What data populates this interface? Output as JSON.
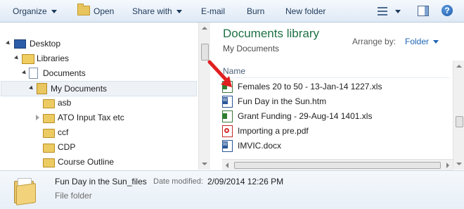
{
  "toolbar": {
    "organize": "Organize",
    "open": "Open",
    "share_with": "Share with",
    "email": "E-mail",
    "burn": "Burn",
    "new_folder": "New folder"
  },
  "nav": {
    "desktop": "Desktop",
    "libraries": "Libraries",
    "documents": "Documents",
    "my_documents": "My Documents",
    "folders": [
      "asb",
      "ATO Input Tax etc",
      "ccf",
      "CDP",
      "Course Outline"
    ]
  },
  "main": {
    "title": "Documents library",
    "subtitle": "My Documents",
    "arrange_label": "Arrange by:",
    "arrange_value": "Folder",
    "column_name": "Name",
    "files": [
      {
        "name": "Females 20 to 50 - 13-Jan-14 1227.xls",
        "icon": "excel-file-icon"
      },
      {
        "name": "Fun Day in the Sun.htm",
        "icon": "word-html-file-icon"
      },
      {
        "name": "Grant Funding - 29-Aug-14 1401.xls",
        "icon": "excel-file-icon"
      },
      {
        "name": "Importing a pre.pdf",
        "icon": "pdf-file-icon"
      },
      {
        "name": "IMVIC.docx",
        "icon": "word-file-icon"
      }
    ]
  },
  "details": {
    "name": "Fun Day in the Sun_files",
    "modified_label": "Date modified:",
    "modified_value": "2/09/2014 12:26 PM",
    "type": "File folder"
  },
  "colors": {
    "title_green": "#1e7145",
    "link_blue": "#1e64b4",
    "arrow_red": "#e02020"
  }
}
